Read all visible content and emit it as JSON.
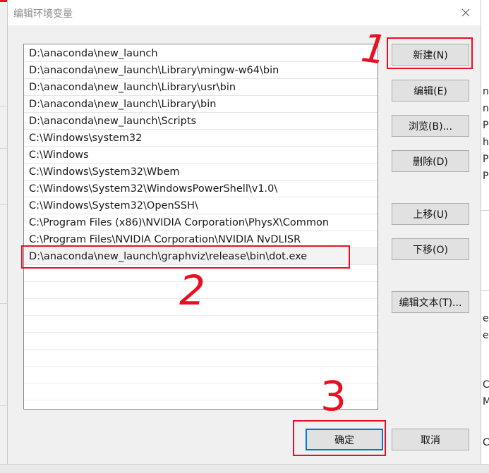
{
  "dialog": {
    "title": "编辑环境变量"
  },
  "paths": [
    "D:\\anaconda\\new_launch",
    "D:\\anaconda\\new_launch\\Library\\mingw-w64\\bin",
    "D:\\anaconda\\new_launch\\Library\\usr\\bin",
    "D:\\anaconda\\new_launch\\Library\\bin",
    "D:\\anaconda\\new_launch\\Scripts",
    "C:\\Windows\\system32",
    "C:\\Windows",
    "C:\\Windows\\System32\\Wbem",
    "C:\\Windows\\System32\\WindowsPowerShell\\v1.0\\",
    "C:\\Windows\\System32\\OpenSSH\\",
    "C:\\Program Files (x86)\\NVIDIA Corporation\\PhysX\\Common",
    "C:\\Program Files\\NVIDIA Corporation\\NVIDIA NvDLISR",
    "D:\\anaconda\\new_launch\\graphviz\\release\\bin\\dot.exe"
  ],
  "selected_index": 12,
  "buttons": {
    "new": "新建(N)",
    "edit": "编辑(E)",
    "browse": "浏览(B)...",
    "delete": "删除(D)",
    "move_up": "上移(U)",
    "move_down": "下移(O)",
    "edit_text": "编辑文本(T)...",
    "ok": "确定",
    "cancel": "取消"
  },
  "background_fragments": [
    "ne",
    "ne",
    "P",
    "h",
    "P",
    "P",
    "er",
    "er",
    "C",
    "M",
    "C"
  ],
  "annotation_color": "#e81123",
  "annotation_marks": [
    "1",
    "2",
    "3"
  ]
}
